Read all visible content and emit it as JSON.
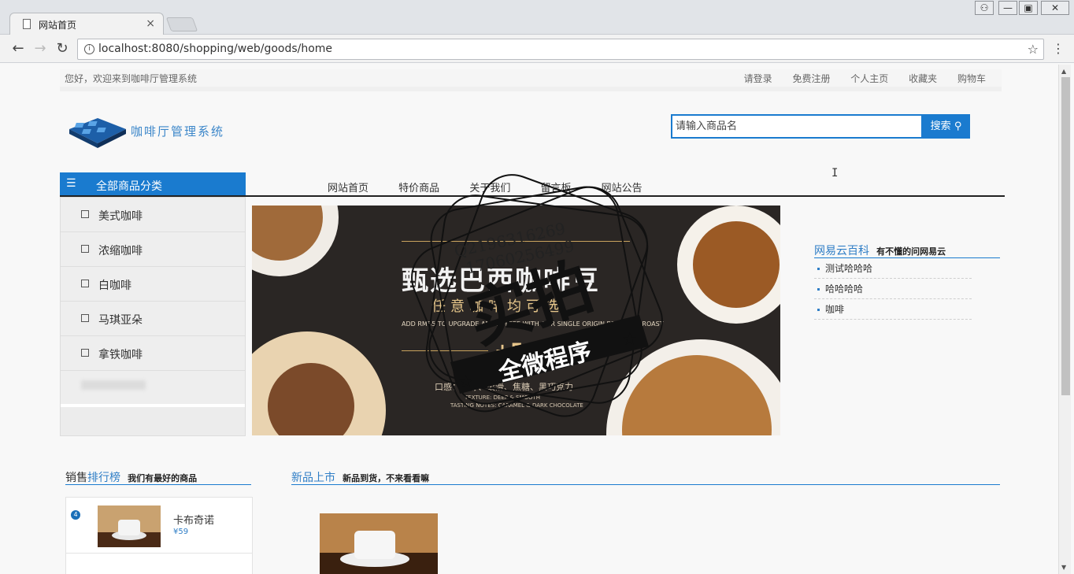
{
  "browser": {
    "tab_title": "网站首页",
    "tab_close": "×",
    "url": "localhost:8080/shopping/web/goods/home",
    "win_buttons": [
      "⚇",
      "—",
      "▣",
      "✕"
    ]
  },
  "site": {
    "welcome": "您好，欢迎来到咖啡厅管理系统",
    "top_links": [
      "请登录",
      "免费注册",
      "个人主页",
      "收藏夹",
      "购物车"
    ],
    "logo_text": "咖啡厅管理系统",
    "search_placeholder": "请输入商品名",
    "search_button": "搜索"
  },
  "category": {
    "header": "全部商品分类",
    "items": [
      "美式咖啡",
      "浓缩咖啡",
      "白咖啡",
      "马琪亚朵",
      "拿铁咖啡"
    ]
  },
  "main_nav": [
    "网站首页",
    "特价商品",
    "关于我们",
    "留言板",
    "网站公告"
  ],
  "banner": {
    "title": "甄选巴西咖啡豆",
    "subtitle": "任意咖啡均可选",
    "english": "ADD RMB5 TO UPGRADE ANY COFFEE WITH OUR SINGLE ORIGIN BRAZILIAN ROAST",
    "plus": "+5",
    "rmb": "RMB",
    "taste": "口感：香醇、柔滑、焦糖、黑巧克力",
    "texture": "TEXTURE: DEEP & SMOOTH",
    "notes": "TASTING NOTES: CARAMEL & DARK CHOCOLATE"
  },
  "watermark": {
    "qq1": "Q2196316269",
    "qq2": "17060256499",
    "big": "实拍",
    "band": "全微程序"
  },
  "wiki": {
    "title": "网易云百科",
    "subtitle": "有不懂的问网易云",
    "items": [
      "测试哈哈哈",
      "哈哈哈哈",
      "咖啡"
    ]
  },
  "sales": {
    "title_a": "销售",
    "title_b": "排行榜",
    "subtitle": "我们有最好的商品",
    "item": {
      "rank": "4",
      "name": "卡布奇诺",
      "price": "¥59"
    }
  },
  "new_arrivals": {
    "title": "新品上市",
    "subtitle": "新品到货，不来看看嘛"
  },
  "colors": {
    "accent": "#1a7bcf",
    "link": "#2f7ec6"
  }
}
